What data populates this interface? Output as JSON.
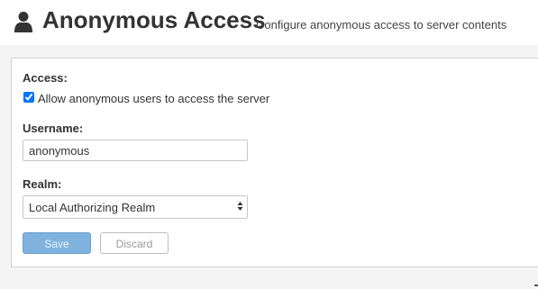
{
  "header": {
    "icon": "user-icon",
    "title": "Anonymous Access",
    "subtitle": "Configure anonymous access to server contents"
  },
  "form": {
    "access": {
      "label": "Access:",
      "checkbox_label": "Allow anonymous users to access the server",
      "checked": true
    },
    "username": {
      "label": "Username:",
      "value": "anonymous"
    },
    "realm": {
      "label": "Realm:",
      "selected": "Local Authorizing Realm"
    },
    "buttons": {
      "save": "Save",
      "discard": "Discard"
    }
  },
  "colors": {
    "save_button": "#7fb3dd",
    "panel_border": "#d4d4d4",
    "page_background": "#f4f4f4"
  }
}
